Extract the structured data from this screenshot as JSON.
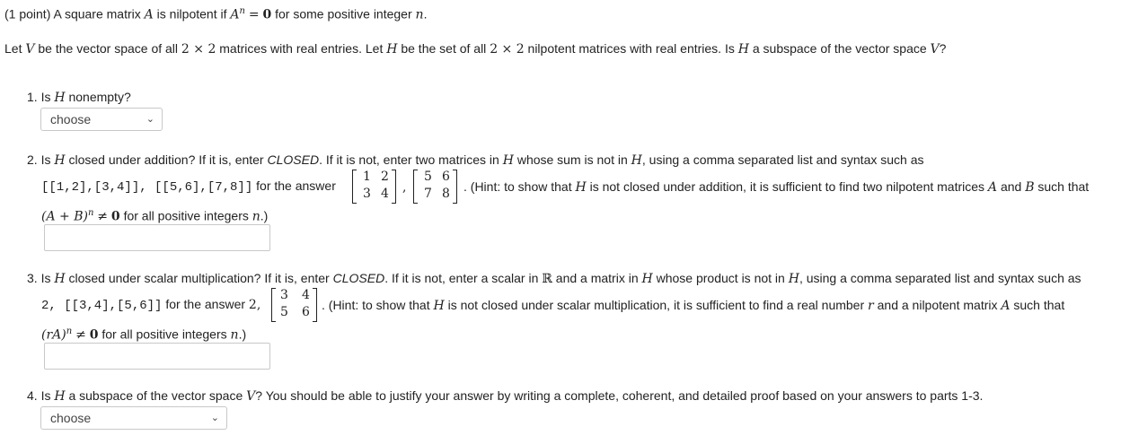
{
  "intro": {
    "points": "(1 point)",
    "def_pre": "A square matrix",
    "A": "A",
    "def_mid": "is nilpotent if",
    "An": "A",
    "n_sup": "n",
    "eq": "=",
    "zero": "0",
    "def_post": "for some positive integer",
    "n": "n",
    "dot": "."
  },
  "setup": {
    "t1": "Let",
    "V": "V",
    "t2": "be the vector space of all",
    "dim1": "2 × 2",
    "t3": "matrices with real entries. Let",
    "H": "H",
    "t4": "be the set of all",
    "dim2": "2 × 2",
    "t5": "nilpotent matrices with real entries. Is",
    "H2": "H",
    "t6": "a subspace of the vector space",
    "V2": "V",
    "t7": "?"
  },
  "q1": {
    "num": "1. Is",
    "H": "H",
    "rest": "nonempty?",
    "select_value": "choose"
  },
  "q2": {
    "line1_a": "2. Is",
    "H": "H",
    "line1_b": "closed under addition? If it is, enter",
    "closed": "CLOSED",
    "line1_c": ". If it is not, enter two matrices in",
    "H2": "H",
    "line1_d": "whose sum is not in",
    "H3": "H",
    "line1_e": ", using a comma separated list and syntax such as",
    "code": "[[1,2],[3,4]], [[5,6],[7,8]]",
    "for_answer": "for the answer",
    "m1": [
      "1",
      "2",
      "3",
      "4"
    ],
    "comma": ",",
    "m2": [
      "5",
      "6",
      "7",
      "8"
    ],
    "hint_a": ". (Hint: to show that",
    "H4": "H",
    "hint_b": "is not closed under addition, it is sufficient to find two nilpotent matrices",
    "A": "A",
    "and": "and",
    "B": "B",
    "hint_c": "such that",
    "expr": "(A + B)",
    "n_sup": "n",
    "neq": "≠",
    "zero": "0",
    "tail": "for all positive integers",
    "n": "n",
    "end": ".)",
    "input_value": ""
  },
  "q3": {
    "line1_a": "3. Is",
    "H": "H",
    "line1_b": "closed under scalar multiplication? If it is, enter",
    "closed": "CLOSED",
    "line1_c": ". If it is not, enter a scalar in",
    "R": "ℝ",
    "line1_d": "and a matrix in",
    "H2": "H",
    "line1_e": "whose product is not in",
    "H3": "H",
    "line1_f": ", using a comma separated list and syntax such as",
    "code": "2, [[3,4],[5,6]]",
    "for_answer": "for the answer",
    "scalar": "2,",
    "m": [
      "3",
      "4",
      "5",
      "6"
    ],
    "hint_a": ". (Hint: to show that",
    "H4": "H",
    "hint_b": "is not closed under scalar multiplication, it is sufficient to find a real number",
    "r": "r",
    "hint_c": "and a nilpotent matrix",
    "A": "A",
    "hint_d": "such that",
    "expr": "(rA)",
    "n_sup": "n",
    "neq": "≠",
    "zero": "0",
    "tail": "for all positive integers",
    "n": "n",
    "end": ".)",
    "input_value": ""
  },
  "q4": {
    "a": "4. Is",
    "H": "H",
    "b": "a subspace of the vector space",
    "V": "V",
    "c": "? You should be able to justify your answer by writing a complete, coherent, and detailed proof based on your answers to parts 1-3.",
    "select_value": "choose"
  },
  "icons": {
    "dropdown": "chevron-down-icon"
  }
}
